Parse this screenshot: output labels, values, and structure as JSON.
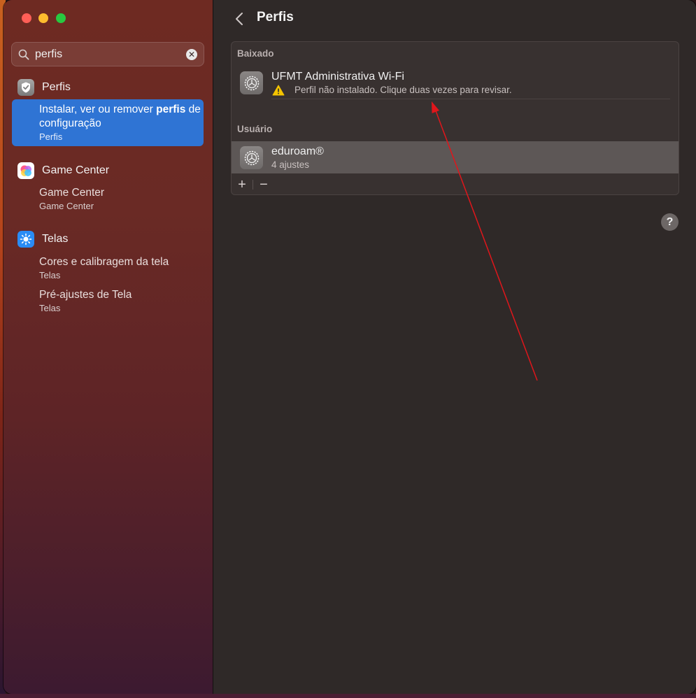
{
  "window": {
    "traffic_lights": [
      "close",
      "minimize",
      "zoom"
    ]
  },
  "sidebar": {
    "search": {
      "value": "perfis",
      "placeholder": ""
    },
    "sections": [
      {
        "title": "Perfis",
        "icon": "profile-check-icon",
        "results": [
          {
            "title_before": "Instalar, ver ou remover ",
            "title_match": "perfis",
            "title_after": " de configuração",
            "sub": "Perfis",
            "selected": true
          }
        ]
      },
      {
        "title": "Game Center",
        "icon": "game-center-icon",
        "results": [
          {
            "title": "Game Center",
            "sub": "Game Center"
          }
        ]
      },
      {
        "title": "Telas",
        "icon": "display-sun-icon",
        "results": [
          {
            "title": "Cores e calibragem da tela",
            "sub": "Telas"
          },
          {
            "title": "Pré-ajustes de Tela",
            "sub": "Telas"
          }
        ]
      }
    ]
  },
  "content": {
    "title": "Perfis",
    "groups": [
      {
        "label": "Baixado",
        "rows": [
          {
            "title": "UFMT Administrativa Wi-Fi",
            "subtitle": "Perfil não instalado. Clique duas vezes para revisar.",
            "warning": true
          }
        ]
      },
      {
        "label": "Usuário",
        "rows": [
          {
            "title": "eduroam®",
            "subtitle": "4 ajustes",
            "selected": true
          }
        ]
      }
    ],
    "toolbar": {
      "add": "+",
      "remove": "−"
    },
    "help": "?"
  },
  "colors": {
    "selection": "#2f74d4",
    "annotation_arrow": "#e0161b"
  }
}
